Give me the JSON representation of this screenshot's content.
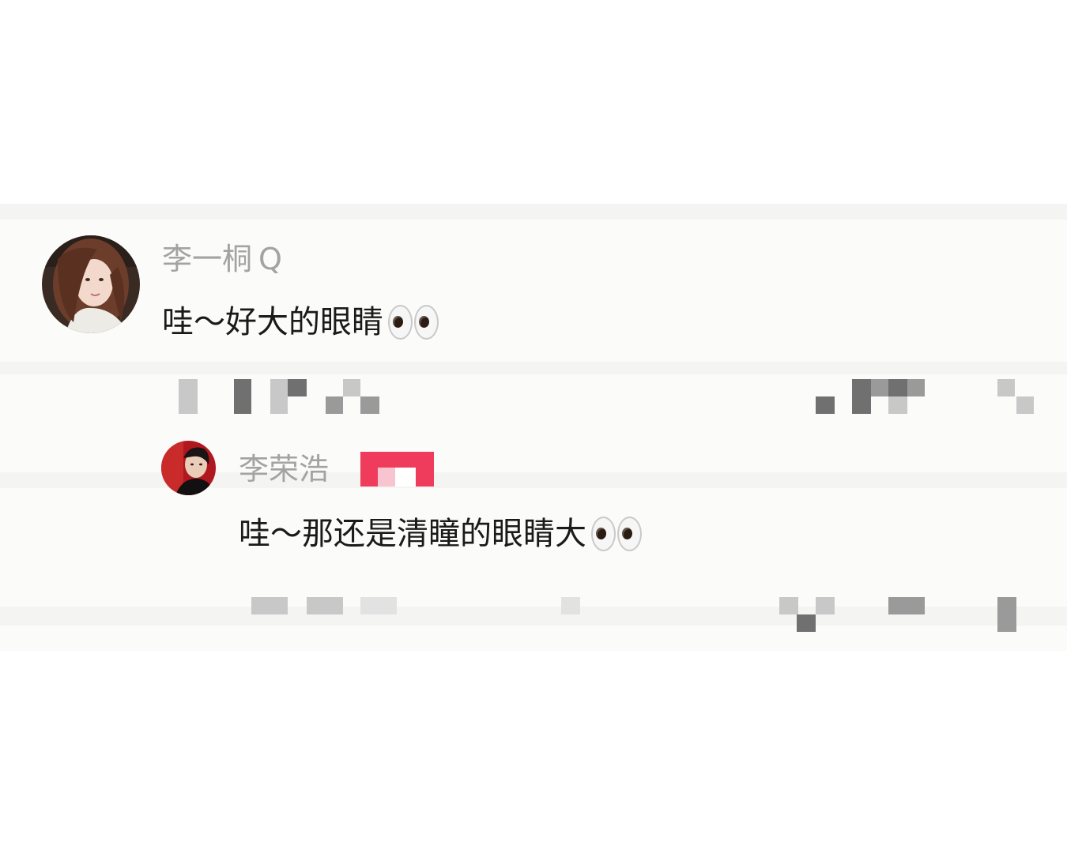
{
  "comments": {
    "main": {
      "username": "李一桐",
      "username_suffix": "Q",
      "text": "哇～好大的眼睛",
      "emoji_icon": "eyes-emoji-icon"
    },
    "reply": {
      "username": "李荣浩",
      "text": "哇～那还是清瞳的眼睛大",
      "emoji_icon": "eyes-emoji-icon",
      "badge_color": "#f03c5c"
    }
  },
  "colors": {
    "username": "#a3a3a3",
    "comment_text": "#1a1a1a",
    "mosaic": "#9a9a9a"
  }
}
